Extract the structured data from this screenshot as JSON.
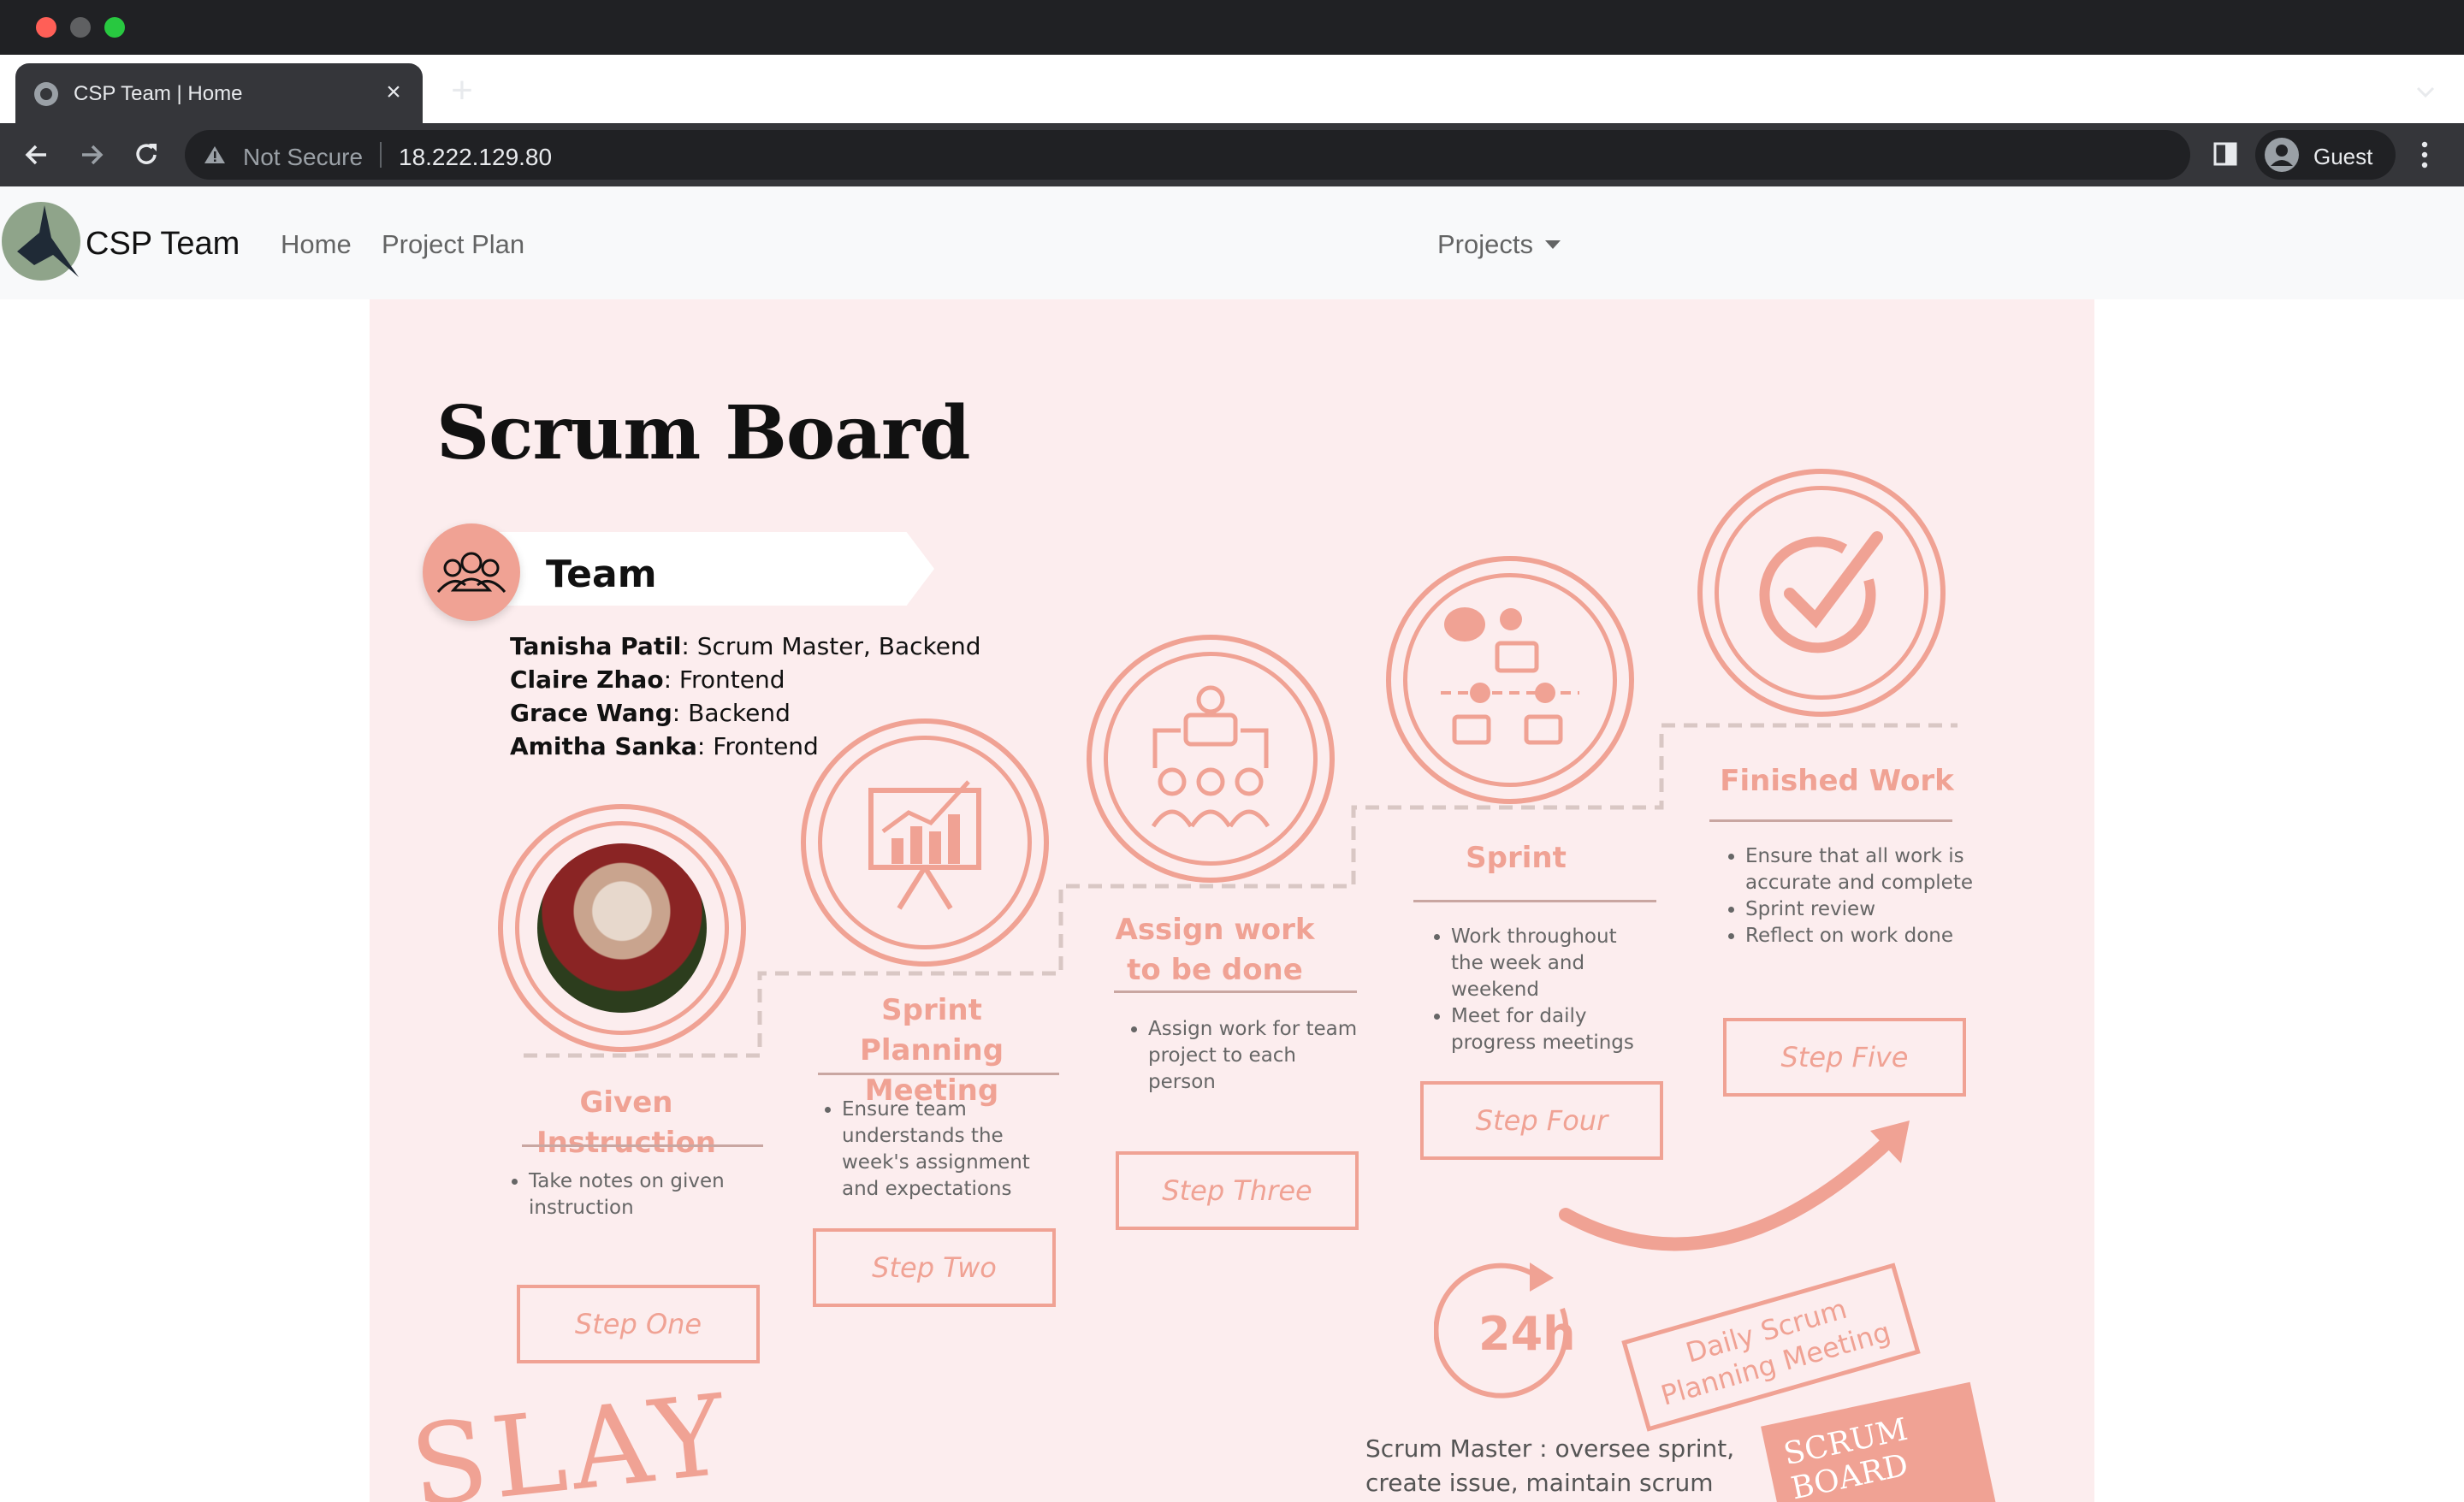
{
  "browser": {
    "tab_title": "CSP Team | Home",
    "new_tab": "+",
    "close": "×",
    "security": "Not Secure",
    "url": "18.222.129.80",
    "profile_name": "Guest"
  },
  "navbar": {
    "brand": "CSP Team",
    "links": [
      "Home",
      "Project Plan"
    ],
    "dropdown": "Projects"
  },
  "board": {
    "title": "Scrum Board",
    "team_heading": "Team",
    "team": [
      {
        "name": "Tanisha Patil",
        "role": ": Scrum Master, Backend"
      },
      {
        "name": "Claire Zhao",
        "role": ": Frontend"
      },
      {
        "name": "Grace Wang",
        "role": ": Backend"
      },
      {
        "name": "Amitha Sanka",
        "role": ": Frontend"
      }
    ],
    "steps": [
      {
        "title": "Given Instruction",
        "bullets": [
          "Take notes on given instruction"
        ],
        "button": "Step One"
      },
      {
        "title": "Sprint Planning Meeting",
        "bullets": [
          "Ensure team understands the week's assignment and expectations"
        ],
        "button": "Step Two"
      },
      {
        "title": "Assign work to be done",
        "bullets": [
          "Assign work for team project to each person"
        ],
        "button": "Step Three"
      },
      {
        "title": "Sprint",
        "bullets": [
          "Work throughout the week and weekend",
          "Meet for daily progress meetings"
        ],
        "button": "Step Four"
      },
      {
        "title": "Finished Work",
        "bullets": [
          "Ensure that all work is accurate and complete",
          "Sprint review",
          "Reflect on work done"
        ],
        "button": "Step Five"
      }
    ],
    "daily_scrum": "Daily Scrum Planning Meeting",
    "clock_label": "24h",
    "scrum_master_note": "Scrum Master : oversee sprint, create issue, maintain scrum",
    "scrum_board_note": "SCRUM BOARD",
    "slay": "SLAY"
  },
  "colors": {
    "accent": "#f0a294",
    "board_bg": "#fcedee",
    "chrome_dark": "#202124",
    "chrome_mid": "#35363a"
  }
}
